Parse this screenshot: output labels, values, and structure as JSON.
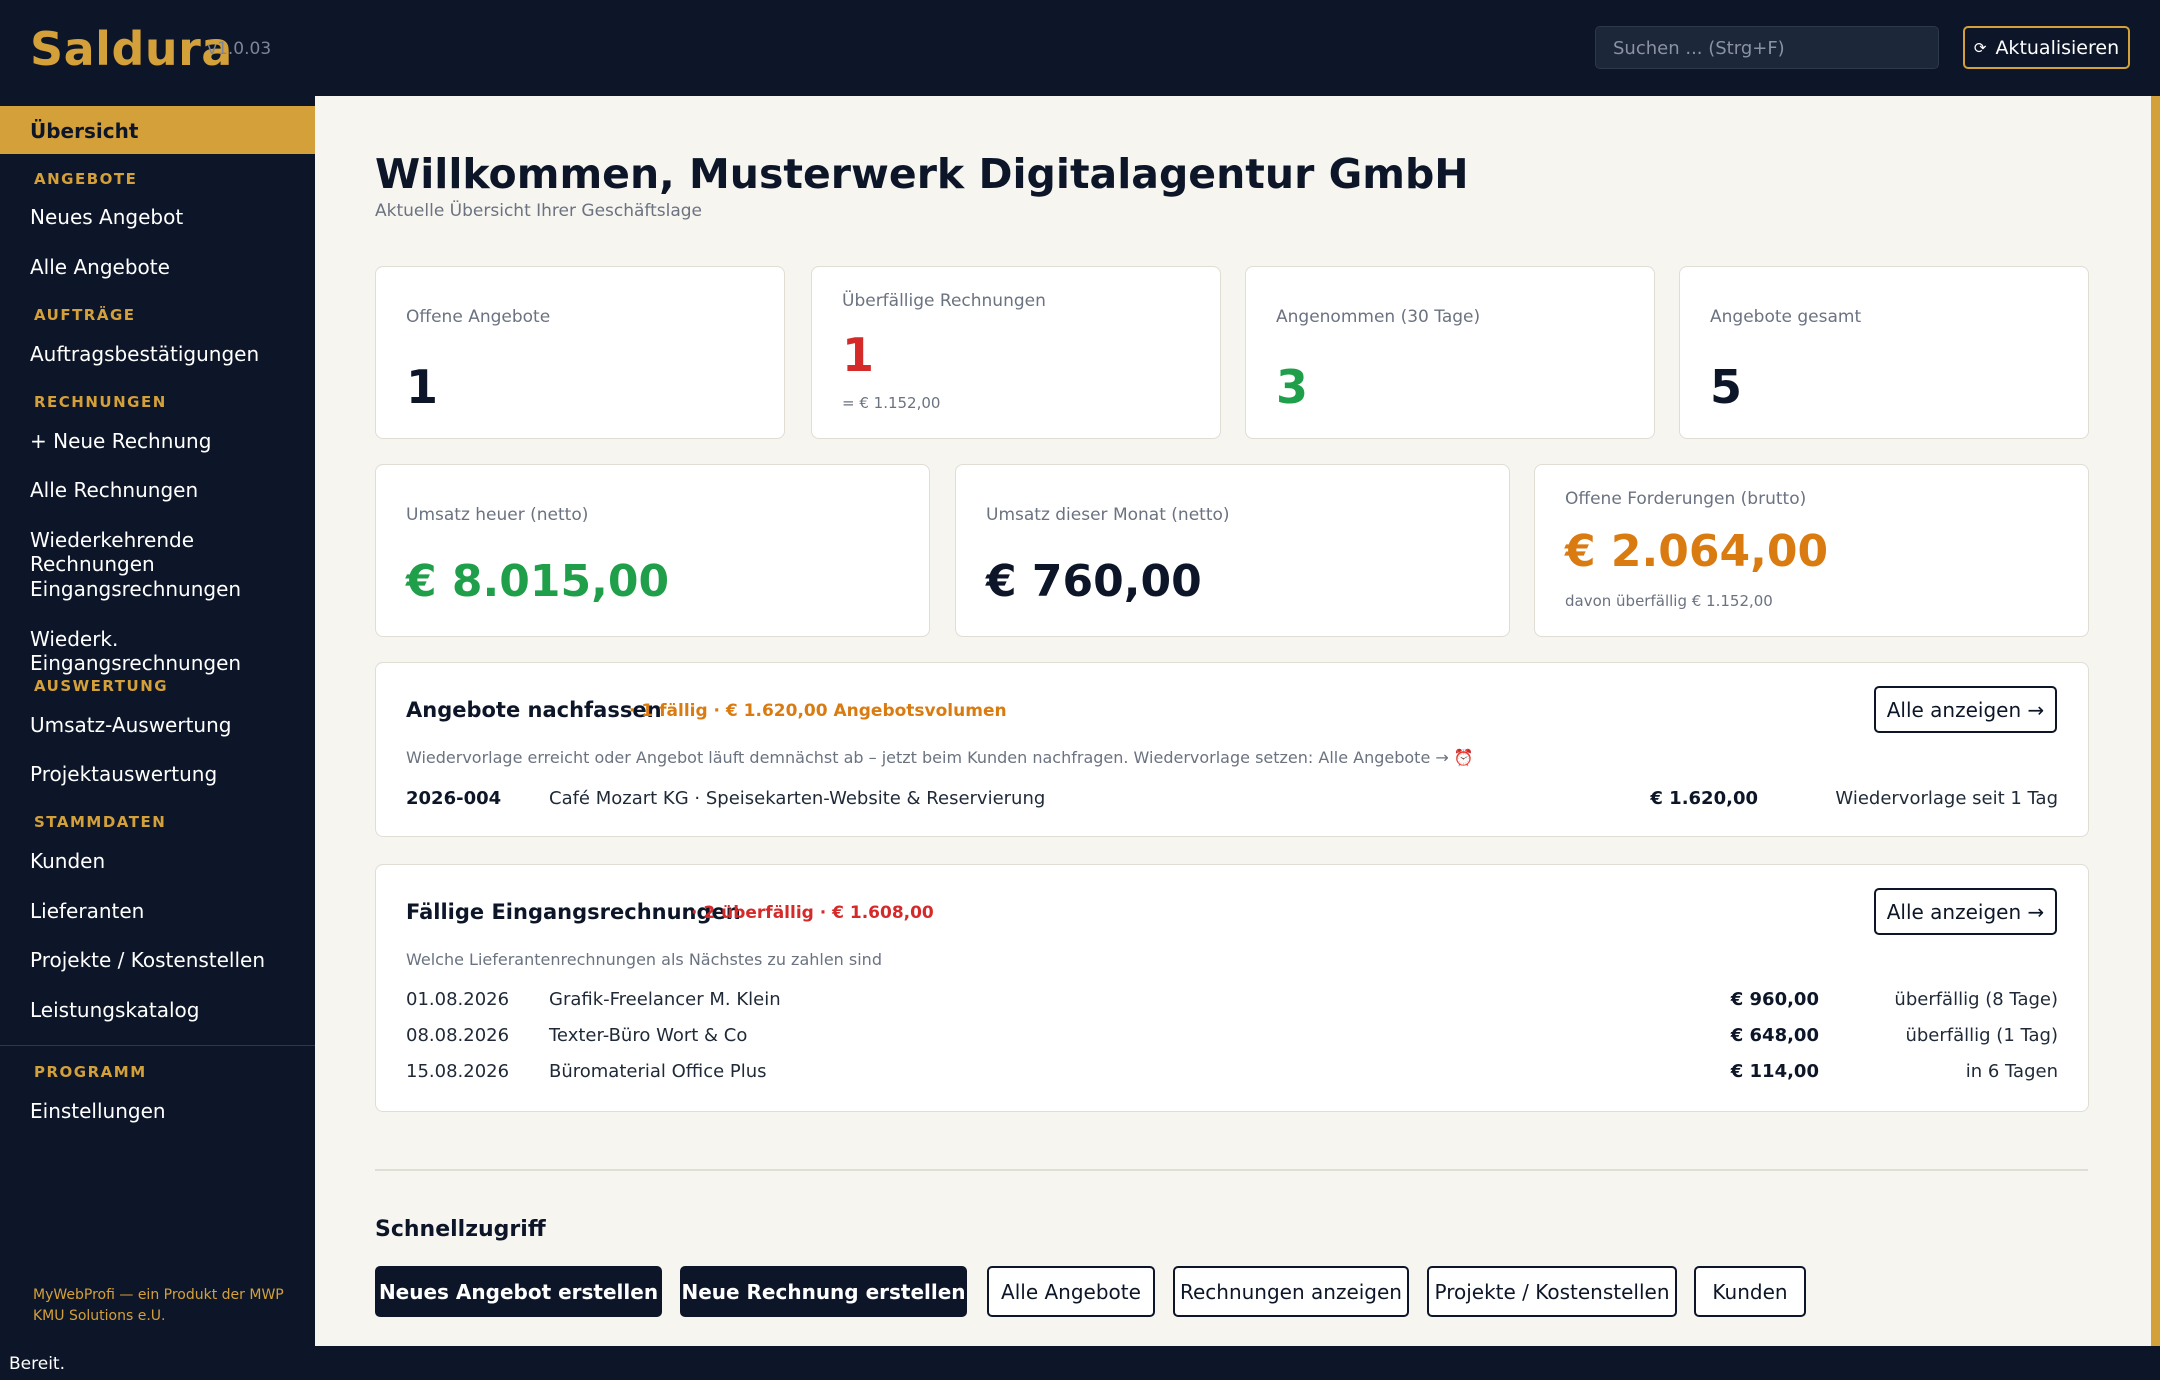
{
  "app": {
    "name": "Saldura",
    "version": "v1.0.03",
    "search_placeholder": "Suchen ...  (Strg+F)",
    "refresh_label": "Aktualisieren"
  },
  "sidebar": {
    "active": "Übersicht",
    "sections": {
      "angebote": "ANGEBOTE",
      "auftraege": "AUFTRÄGE",
      "rechnungen": "RECHNUNGEN",
      "auswertung": "AUSWERTUNG",
      "stammdaten": "STAMMDATEN",
      "programm": "PROGRAMM"
    },
    "items": {
      "neues_angebot": "Neues Angebot",
      "alle_angebote": "Alle Angebote",
      "auftragsbestaetigungen": "Auftragsbestätigungen",
      "neue_rechnung": "+ Neue Rechnung",
      "alle_rechnungen": "Alle Rechnungen",
      "wiederkehrende": "Wiederkehrende Rechnungen",
      "eingangsrechnungen": "Eingangsrechnungen",
      "wiederk_eingang": "Wiederk. Eingangsrechnungen",
      "umsatz_auswertung": "Umsatz-Auswertung",
      "projektauswertung": "Projektauswertung",
      "kunden": "Kunden",
      "lieferanten": "Lieferanten",
      "projekte": "Projekte / Kostenstellen",
      "leistungskatalog": "Leistungskatalog",
      "einstellungen": "Einstellungen"
    },
    "footer": "MyWebProfi — ein Produkt der MWP KMU Solutions e.U."
  },
  "main": {
    "title": "Willkommen, Musterwerk Digitalagentur GmbH",
    "subtitle": "Aktuelle Übersicht Ihrer Geschäftslage",
    "kpis": {
      "offene_angebote": {
        "label": "Offene Angebote",
        "value": "1"
      },
      "ueberfaellige": {
        "label": "Überfällige Rechnungen",
        "value": "1",
        "sub": "= € 1.152,00"
      },
      "angenommen": {
        "label": "Angenommen (30 Tage)",
        "value": "3"
      },
      "gesamt": {
        "label": "Angebote gesamt",
        "value": "5"
      },
      "umsatz_heuer": {
        "label": "Umsatz heuer (netto)",
        "value": "€ 8.015,00"
      },
      "umsatz_monat": {
        "label": "Umsatz dieser Monat (netto)",
        "value": "€ 760,00"
      },
      "forderungen": {
        "label": "Offene Forderungen (brutto)",
        "value": "€ 2.064,00",
        "sub": "davon überfällig € 1.152,00"
      }
    },
    "nachfassen": {
      "title": "Angebote nachfassen",
      "badge": "· 1 fällig · € 1.620,00 Angebotsvolumen",
      "desc": "Wiedervorlage erreicht oder Angebot läuft demnächst ab – jetzt beim Kunden nachfragen. Wiedervorlage setzen: Alle Angebote → ⏰",
      "button": "Alle anzeigen →",
      "rows": [
        {
          "nr": "2026-004",
          "kunde": "Café Mozart KG  ·  Speisekarten-Website & Reservierung",
          "betrag": "€ 1.620,00",
          "status": "Wiedervorlage seit 1 Tag"
        }
      ]
    },
    "eingang": {
      "title": "Fällige Eingangsrechnungen",
      "badge": "· 2 überfällig · € 1.608,00",
      "desc": "Welche Lieferantenrechnungen als Nächstes zu zahlen sind",
      "button": "Alle anzeigen →",
      "rows": [
        {
          "datum": "01.08.2026",
          "lieferant": "Grafik-Freelancer M. Klein",
          "betrag": "€ 960,00",
          "status": "überfällig (8 Tage)"
        },
        {
          "datum": "08.08.2026",
          "lieferant": "Texter-Büro Wort & Co",
          "betrag": "€ 648,00",
          "status": "überfällig (1 Tag)"
        },
        {
          "datum": "15.08.2026",
          "lieferant": "Büromaterial Office Plus",
          "betrag": "€ 114,00",
          "status": "in 6 Tagen"
        }
      ]
    },
    "quick": {
      "title": "Schnellzugriff",
      "buttons": [
        "Neues Angebot erstellen",
        "Neue Rechnung erstellen",
        "Alle Angebote",
        "Rechnungen anzeigen",
        "Projekte / Kostenstellen",
        "Kunden"
      ]
    }
  },
  "status": "Bereit.",
  "colors": {
    "navy": "#0d1628",
    "gold": "#d4a03a",
    "red": "#d42a2a",
    "green": "#1f9f4a",
    "orange": "#d97b10"
  },
  "icons": {
    "refresh": "refresh-icon",
    "alarm": "alarm-clock-icon"
  }
}
